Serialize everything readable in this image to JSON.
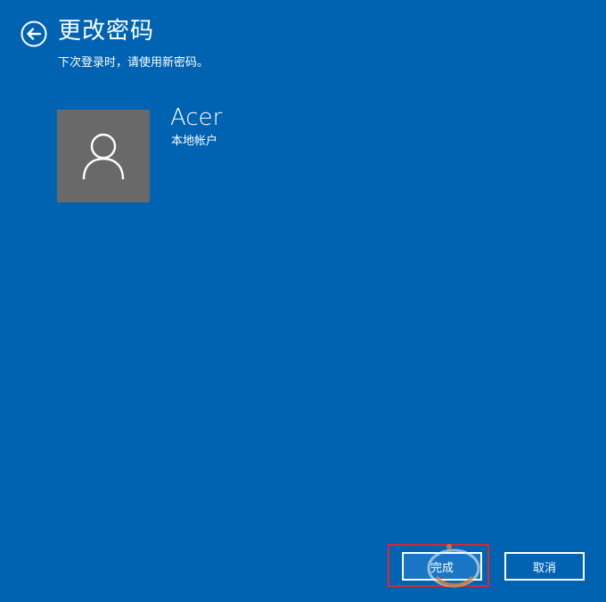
{
  "header": {
    "title": "更改密码",
    "subtitle": "下次登录时，请使用新密码。",
    "back_icon": "back-arrow-icon"
  },
  "account": {
    "name": "Acer",
    "type": "本地帐户",
    "avatar_icon": "user-icon"
  },
  "footer": {
    "finish_label": "完成",
    "cancel_label": "取消"
  },
  "colors": {
    "background": "#0063b1",
    "avatar_bg": "#696969",
    "highlight": "#e0242a"
  }
}
